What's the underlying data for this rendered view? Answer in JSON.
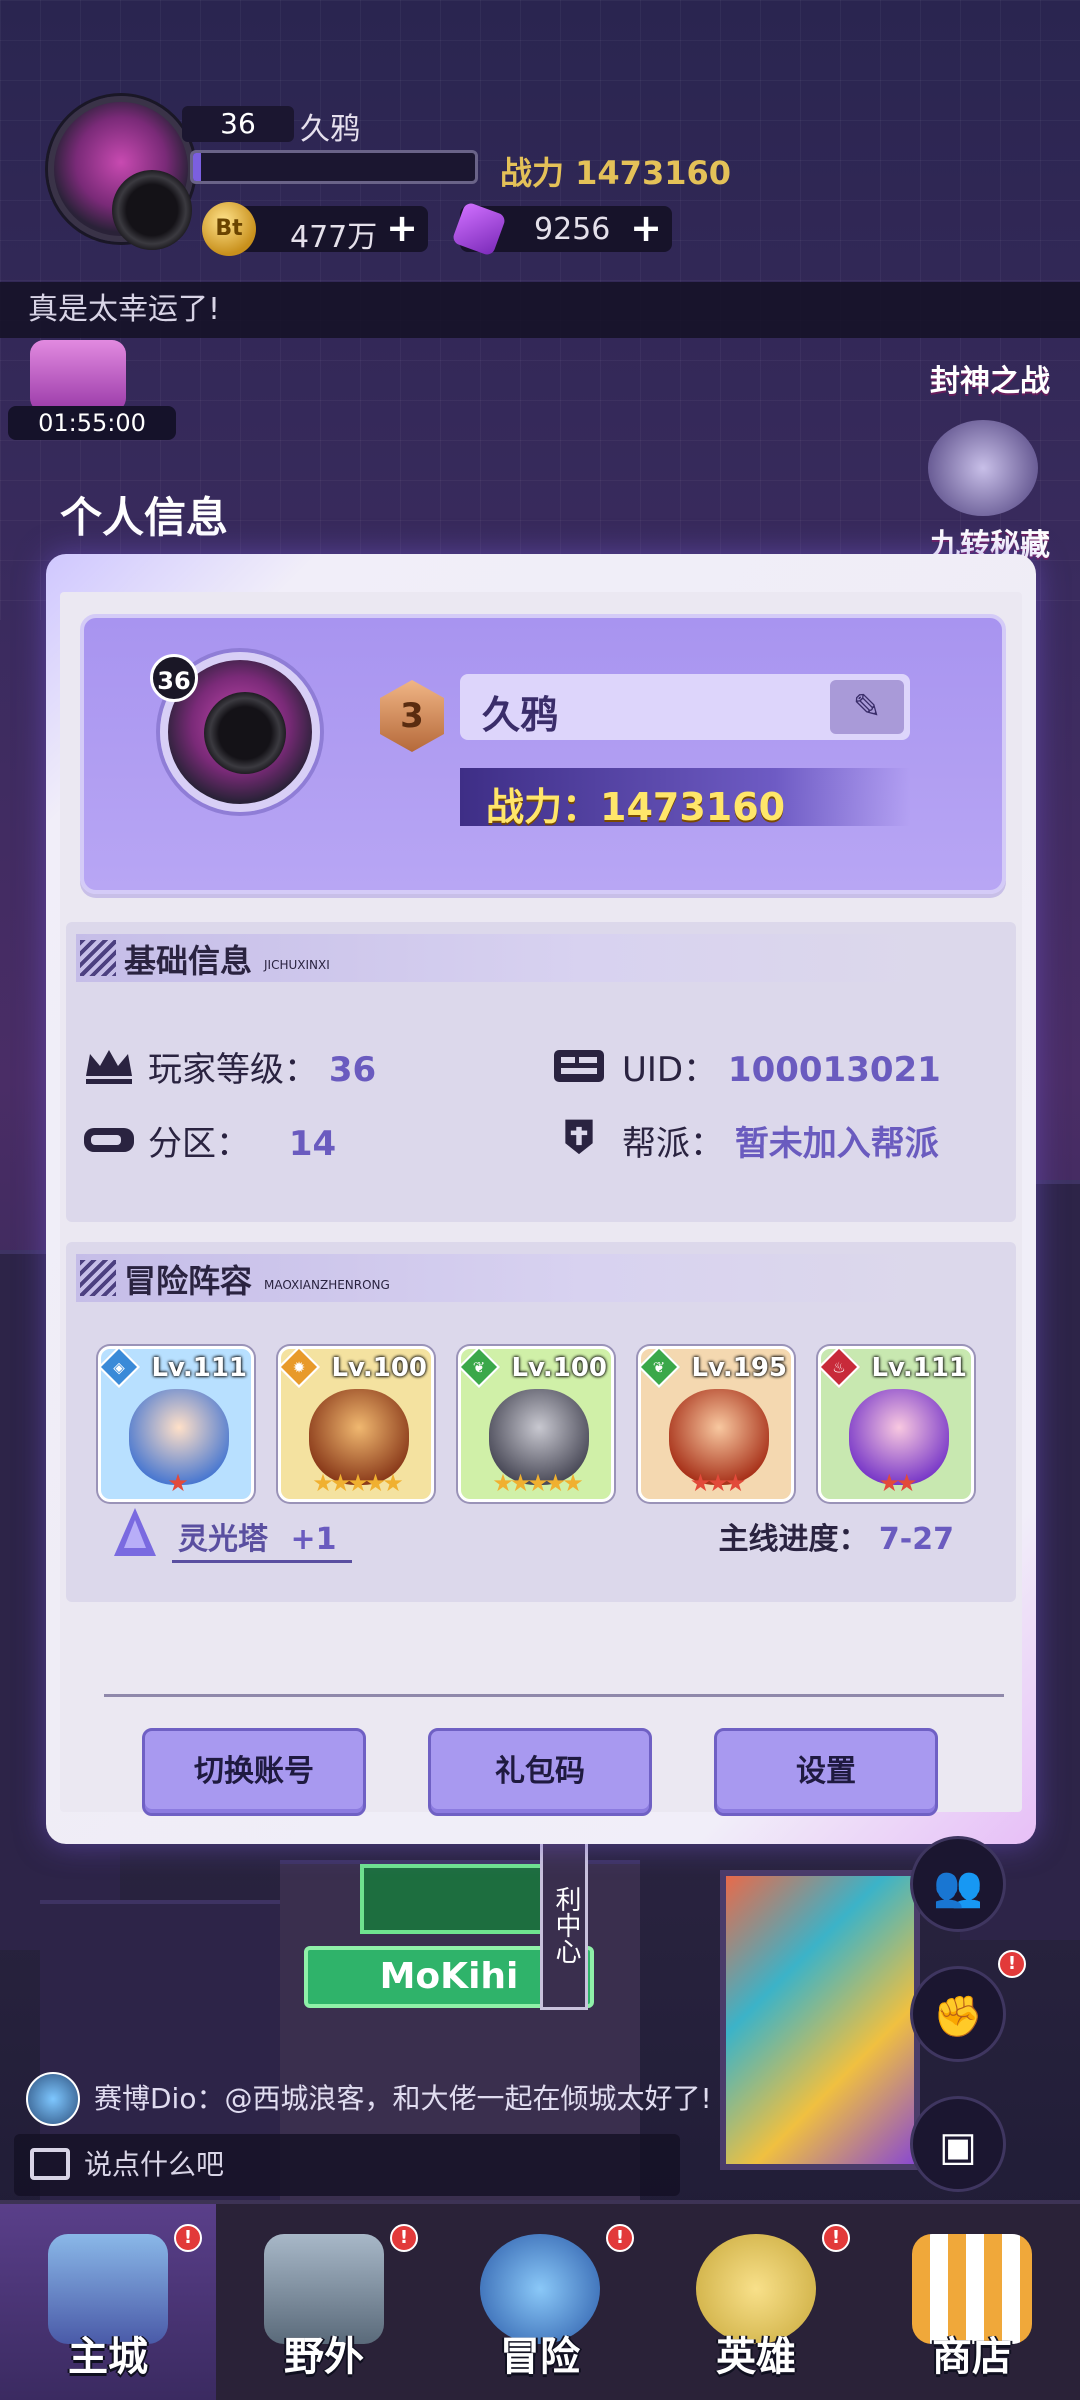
{
  "hud": {
    "level": "36",
    "name": "久鸦",
    "exp_fraction": 0.03,
    "power_label": "战力 1473160",
    "gold_icon_text": "Bt",
    "gold": "477万",
    "gems": "9256",
    "plus": "+",
    "ticker": "真是太幸运了!"
  },
  "side_events": {
    "timer": "01:55:00",
    "event1": "封神之战",
    "event2": "九转秘藏"
  },
  "panel": {
    "title": "个人信息",
    "profile": {
      "level": "36",
      "rank": "3",
      "name": "久鸦",
      "edit_glyph": "✎",
      "power": "战力：1473160"
    },
    "basic": {
      "title": "基础信息",
      "subtitle": "JICHUXINXI",
      "player_level_label": "玩家等级：",
      "player_level": "36",
      "uid_label": "UID：",
      "uid": "100013021",
      "zone_label": "分区：",
      "zone": "14",
      "guild_label": "帮派：",
      "guild": "暂未加入帮派"
    },
    "lineup": {
      "title": "冒险阵容",
      "subtitle": "MAOXIANZHENRONG",
      "heroes": [
        {
          "level": "Lv.111",
          "stars": "★",
          "element": "water"
        },
        {
          "level": "Lv.100",
          "stars": "★★★★★",
          "element": "sun"
        },
        {
          "level": "Lv.100",
          "stars": "★★★★★",
          "element": "nature"
        },
        {
          "level": "Lv.195",
          "stars": "★★★",
          "element": "nature"
        },
        {
          "level": "Lv.111",
          "stars": "★★",
          "element": "fire"
        }
      ],
      "tower_label": "灵光塔",
      "tower_value": "+1",
      "progress_label": "主线进度：",
      "progress_value": "7-27"
    },
    "buttons": {
      "switch_account": "切换账号",
      "gift_code": "礼包码",
      "settings": "设置"
    }
  },
  "city": {
    "sign": "MoKihi",
    "center_sign": "利中心"
  },
  "chat": {
    "user": "赛博Dio：",
    "message": "@西城浪客，和大佬一起在倾城太好了!",
    "placeholder": "说点什么吧"
  },
  "nav": [
    {
      "label": "主城",
      "badge": "!"
    },
    {
      "label": "野外",
      "badge": "!"
    },
    {
      "label": "冒险",
      "badge": "!"
    },
    {
      "label": "英雄",
      "badge": "!"
    },
    {
      "label": "商店",
      "badge": ""
    }
  ],
  "colors": {
    "accent": "#a899f0",
    "power_gold": "#ffe66a",
    "value_purple": "#6a5bbf",
    "badge_red": "#e23a3a"
  }
}
